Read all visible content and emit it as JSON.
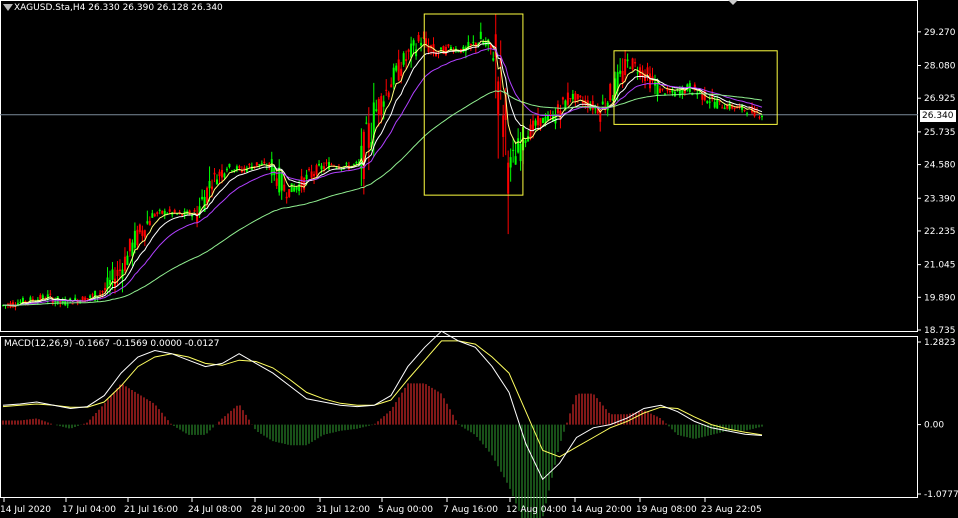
{
  "header": {
    "symbol": "XAGUSD.Sta,H4",
    "ohlc": "26.330 26.390 26.128 26.340"
  },
  "indicator": {
    "label": "MACD(12,26,9) -0.1667 -0.1569 0.0000 -0.0127"
  },
  "current_price": "26.340",
  "colors": {
    "background": "#000000",
    "bull_candle": "#00ff00",
    "bear_candle": "#ff0000",
    "ma_fast": "#ffff80",
    "ma_mid": "#ffffff",
    "ma_slow_purple": "#b040ff",
    "ma_long_green": "#90ee90",
    "macd_pos": "#ff3030",
    "macd_neg": "#30a030",
    "signal": "#ffff60",
    "box": "#ffff40",
    "grid_border": "#ffffff"
  },
  "chart_data": [
    {
      "type": "candlestick",
      "title": "XAGUSD.Sta,H4",
      "y_ticks": [
        "29.270",
        "28.080",
        "26.925",
        "25.735",
        "24.580",
        "23.390",
        "22.235",
        "21.045",
        "19.890",
        "18.735"
      ],
      "ylim": [
        18.735,
        29.9
      ],
      "x_ticks": [
        "14 Jul 2020",
        "17 Jul 04:00",
        "21 Jul 16:00",
        "24 Jul 08:00",
        "28 Jul 20:00",
        "31 Jul 12:00",
        "5 Aug 00:00",
        "7 Aug 16:00",
        "12 Aug 04:00",
        "14 Aug 20:00",
        "19 Aug 08:00",
        "23 Aug 22:05"
      ],
      "close_path": [
        19.6,
        19.7,
        19.8,
        19.9,
        19.7,
        19.8,
        19.9,
        20.2,
        21.0,
        22.0,
        22.8,
        22.9,
        22.8,
        22.9,
        24.0,
        24.5,
        24.4,
        24.6,
        24.5,
        23.6,
        23.9,
        24.4,
        24.6,
        24.5,
        24.6,
        26.5,
        27.5,
        28.3,
        29.0,
        28.5,
        28.7,
        28.6,
        29.0,
        28.4,
        24.5,
        25.6,
        26.1,
        26.3,
        27.0,
        26.8,
        26.5,
        27.3,
        28.2,
        27.8,
        27.2,
        27.1,
        27.3,
        27.0,
        26.7,
        26.6,
        26.5,
        26.34
      ],
      "boxes": [
        {
          "from_date": "6 Aug",
          "to_date": "11 Aug",
          "high": 29.9,
          "low": 23.5
        },
        {
          "from_date": "17 Aug",
          "to_date": "24 Aug",
          "high": 28.6,
          "low": 26.0
        }
      ]
    },
    {
      "type": "histogram",
      "title": "MACD(12,26,9)",
      "y_ticks": [
        "1.2823",
        "0.00",
        "-1.0777"
      ],
      "ylim": [
        -1.0777,
        1.2823
      ],
      "macd": [
        0.3,
        0.32,
        0.35,
        0.3,
        0.25,
        0.28,
        0.45,
        0.8,
        1.05,
        1.15,
        1.1,
        1.0,
        0.9,
        0.95,
        1.1,
        0.95,
        0.8,
        0.6,
        0.4,
        0.35,
        0.3,
        0.28,
        0.3,
        0.45,
        0.9,
        1.2,
        1.45,
        1.3,
        1.2,
        0.9,
        0.5,
        -0.3,
        -0.85,
        -0.6,
        -0.2,
        -0.05,
        0.0,
        0.1,
        0.25,
        0.3,
        0.2,
        0.05,
        -0.05,
        -0.1,
        -0.15,
        -0.17
      ],
      "signal": [
        0.28,
        0.3,
        0.32,
        0.3,
        0.27,
        0.27,
        0.35,
        0.6,
        0.9,
        1.05,
        1.1,
        1.05,
        0.95,
        0.92,
        1.0,
        0.98,
        0.88,
        0.7,
        0.5,
        0.4,
        0.33,
        0.3,
        0.3,
        0.38,
        0.7,
        1.0,
        1.3,
        1.3,
        1.25,
        1.05,
        0.8,
        0.2,
        -0.4,
        -0.5,
        -0.35,
        -0.2,
        -0.05,
        0.05,
        0.18,
        0.27,
        0.25,
        0.12,
        0.0,
        -0.07,
        -0.12,
        -0.16
      ]
    }
  ]
}
